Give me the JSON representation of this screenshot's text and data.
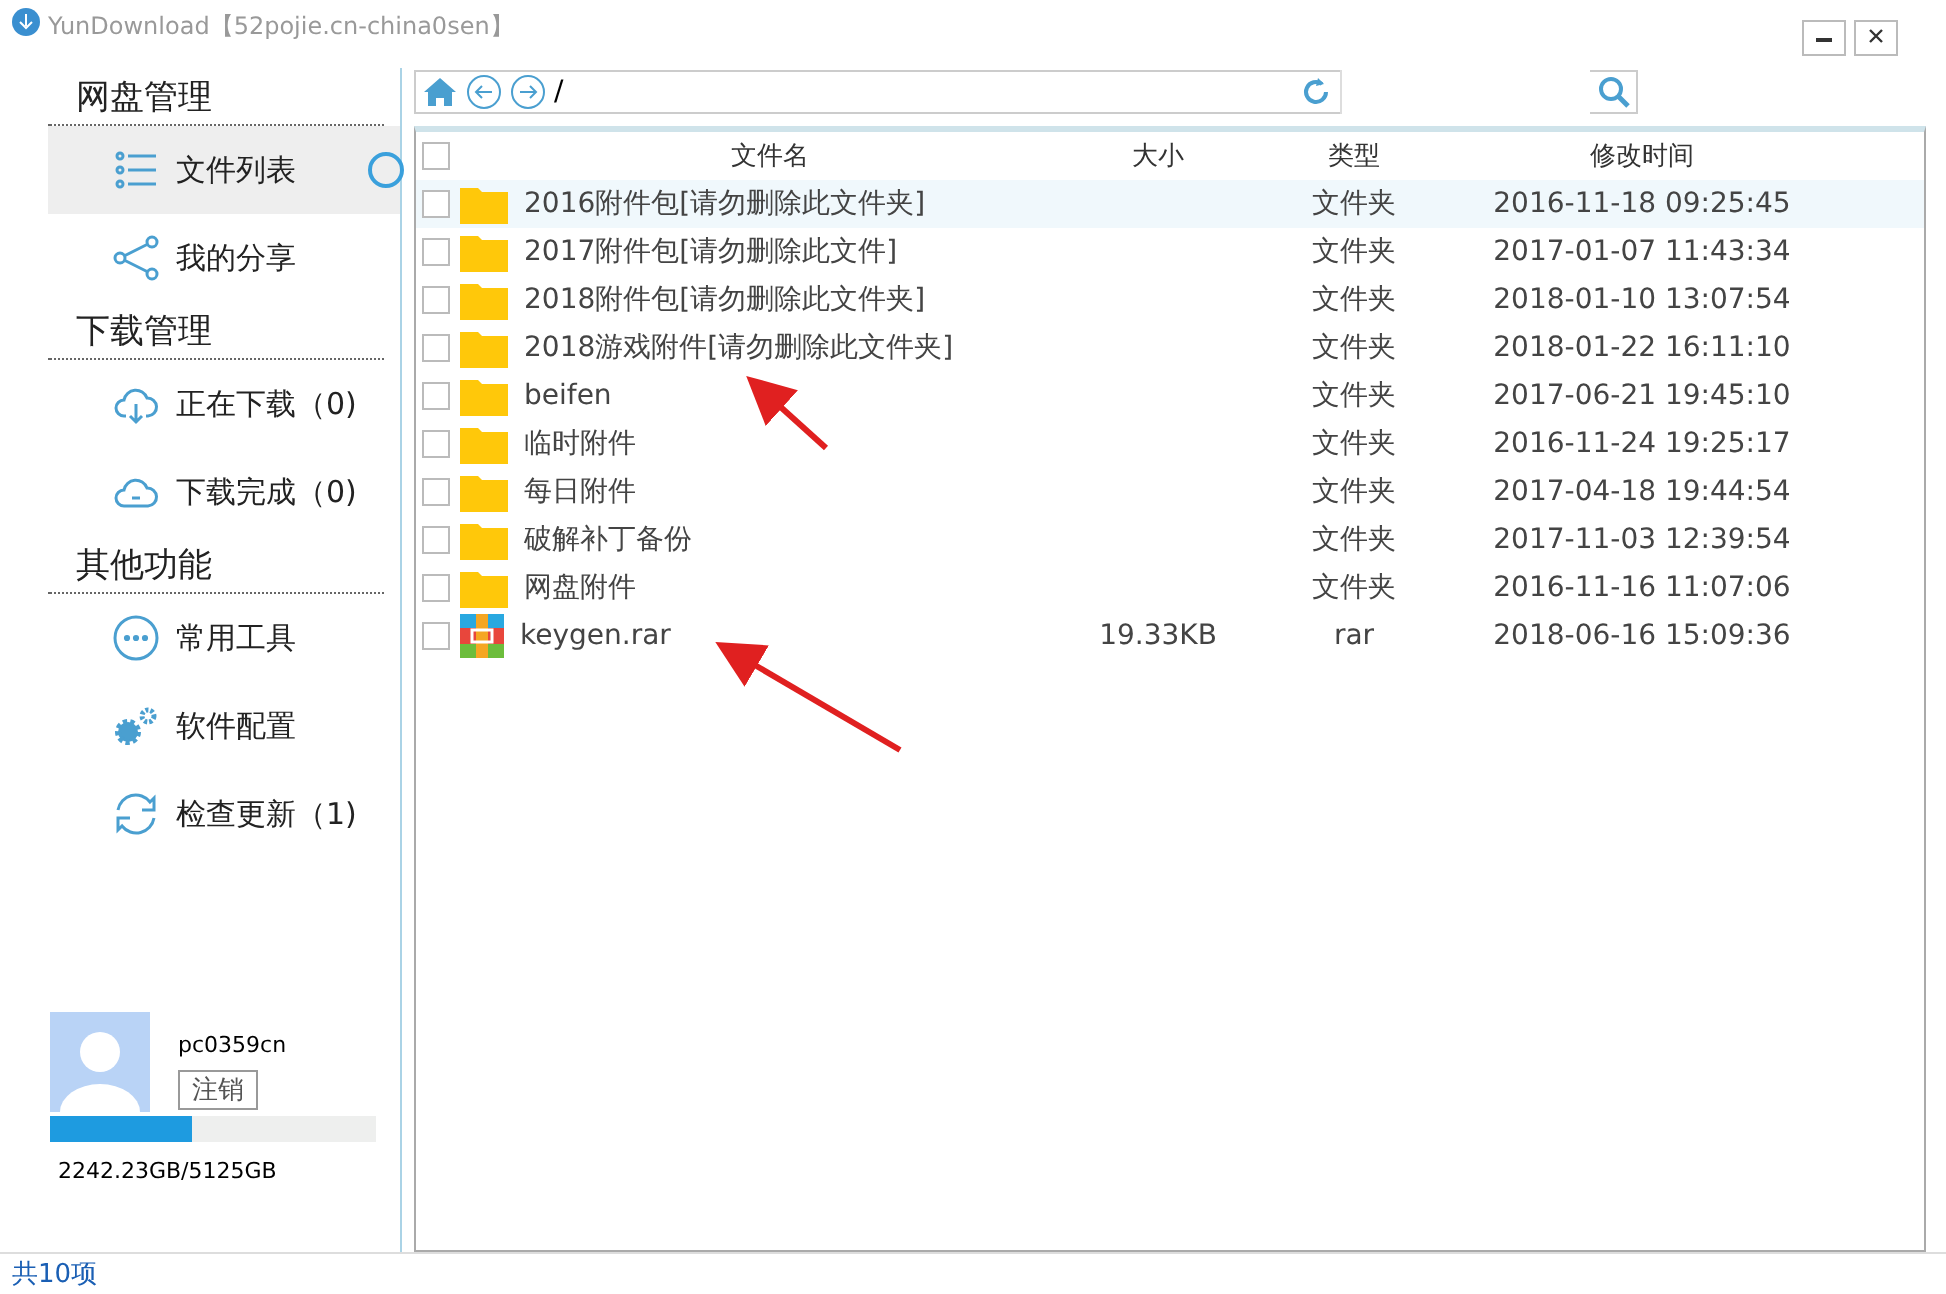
{
  "window": {
    "title": "YunDownload【52pojie.cn-china0sen】"
  },
  "sidebar": {
    "sections": [
      {
        "heading": "网盘管理",
        "items": [
          {
            "label": "文件列表",
            "kind": "list",
            "selected": true
          },
          {
            "label": "我的分享",
            "kind": "share",
            "selected": false
          }
        ]
      },
      {
        "heading": "下载管理",
        "items": [
          {
            "label": "正在下载（0)",
            "kind": "download",
            "selected": false
          },
          {
            "label": "下载完成（0)",
            "kind": "done",
            "selected": false
          }
        ]
      },
      {
        "heading": "其他功能",
        "items": [
          {
            "label": "常用工具",
            "kind": "tools",
            "selected": false
          },
          {
            "label": "软件配置",
            "kind": "settings",
            "selected": false
          },
          {
            "label": "检查更新（1)",
            "kind": "update",
            "selected": false
          }
        ]
      }
    ],
    "user": {
      "name": "pc0359cn",
      "logout": "注销",
      "level": 0.4375,
      "storage": "2242.23GB/5125GB"
    }
  },
  "toolbar": {
    "path": "/"
  },
  "table": {
    "select_all_checked": false,
    "columns": [
      "文件名",
      "大小",
      "类型",
      "修改时间"
    ],
    "rows": [
      {
        "name": "2016附件包[请勿删除此文件夹]",
        "kind": "folder",
        "type": "文件夹",
        "modified": "2016-11-18 09:25:45",
        "selected": true,
        "checked": false
      },
      {
        "name": "2017附件包[请勿删除此文件]",
        "kind": "folder",
        "type": "文件夹",
        "modified": "2017-01-07 11:43:34",
        "selected": false,
        "checked": false
      },
      {
        "name": "2018附件包[请勿删除此文件夹]",
        "kind": "folder",
        "type": "文件夹",
        "modified": "2018-01-10 13:07:54",
        "selected": false,
        "checked": false
      },
      {
        "name": "2018游戏附件[请勿删除此文件夹]",
        "kind": "folder",
        "type": "文件夹",
        "modified": "2018-01-22 16:11:10",
        "selected": false,
        "checked": false
      },
      {
        "name": "beifen",
        "kind": "folder",
        "type": "文件夹",
        "modified": "2017-06-21 19:45:10",
        "selected": false,
        "checked": false
      },
      {
        "name": "临时附件",
        "kind": "folder",
        "type": "文件夹",
        "modified": "2016-11-24 19:25:17",
        "selected": false,
        "checked": false
      },
      {
        "name": "每日附件",
        "kind": "folder",
        "type": "文件夹",
        "modified": "2017-04-18 19:44:54",
        "selected": false,
        "checked": false
      },
      {
        "name": "破解补丁备份",
        "kind": "folder",
        "type": "文件夹",
        "modified": "2017-11-03 12:39:54",
        "selected": false,
        "checked": false
      },
      {
        "name": "网盘附件",
        "kind": "folder",
        "type": "文件夹",
        "modified": "2016-11-16 11:07:06",
        "selected": false,
        "checked": false
      },
      {
        "name": "keygen.rar",
        "kind": "archive",
        "size": "19.33KB",
        "type": "rar",
        "modified": "2018-06-16 15:09:36",
        "selected": false,
        "checked": false
      }
    ]
  },
  "status_bar": "共10项"
}
